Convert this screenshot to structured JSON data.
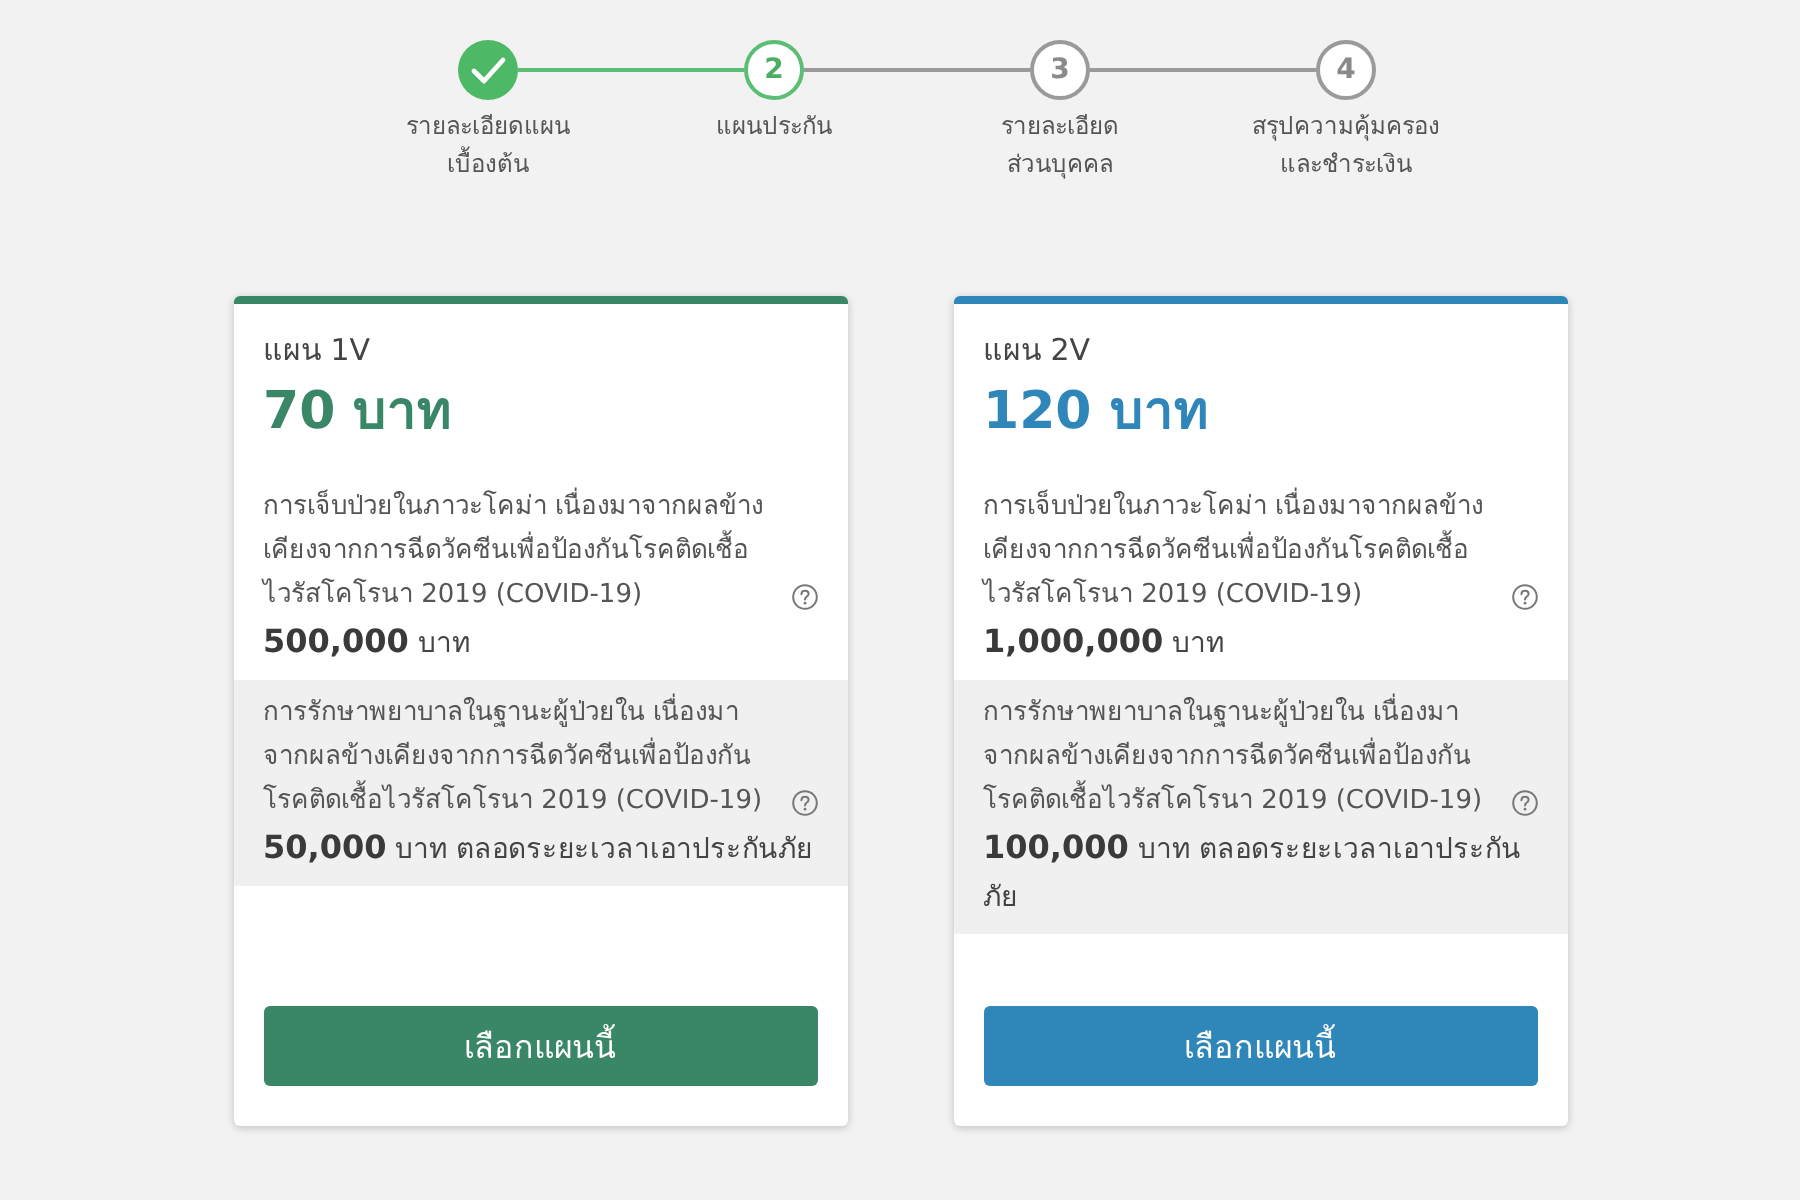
{
  "stepper": {
    "steps": [
      {
        "done": true,
        "selected": false,
        "label": "รายละเอียดแผน\nเบื้องต้น"
      },
      {
        "done": false,
        "selected": true,
        "number": "2",
        "label": "แผนประกัน"
      },
      {
        "done": false,
        "selected": false,
        "number": "3",
        "label": "รายละเอียด\nส่วนบุคคล"
      },
      {
        "done": false,
        "selected": false,
        "number": "4",
        "label": "สรุปความคุ้มครอง\nและชำระเงิน"
      }
    ]
  },
  "plans": [
    {
      "name": "แผน 1V",
      "price": "70 บาท",
      "color": "#3a8768",
      "coverages": [
        {
          "description": "การเจ็บป่วยในภาวะโคม่า เนื่องมาจากผลข้างเคียงจากการฉีดวัคซีนเพื่อป้องกันโรคติดเชื้อไวรัสโคโรนา 2019 (COVID-19)",
          "amount": "**500,000** บาท"
        },
        {
          "description": "การรักษาพยาบาลในฐานะผู้ป่วยใน เนื่องมาจากผลข้างเคียงจากการฉีดวัคซีนเพื่อป้องกันโรคติดเชื้อไวรัสโคโรนา 2019 (COVID-19)",
          "amount": "**50,000** บาท ตลอดระยะเวลาเอาประกันภัย"
        }
      ],
      "button": "เลือกแผนนี้"
    },
    {
      "name": "แผน 2V",
      "price": "120 บาท",
      "color": "#2e86b9",
      "coverages": [
        {
          "description": "การเจ็บป่วยในภาวะโคม่า เนื่องมาจากผลข้างเคียงจากการฉีดวัคซีนเพื่อป้องกันโรคติดเชื้อไวรัสโคโรนา 2019 (COVID-19)",
          "amount": "**1,000,000** บาท"
        },
        {
          "description": "การรักษาพยาบาลในฐานะผู้ป่วยใน เนื่องมาจากผลข้างเคียงจากการฉีดวัคซีนเพื่อป้องกันโรคติดเชื้อไวรัสโคโรนา 2019 (COVID-19)",
          "amount": "**100,000** บาท ตลอดระยะเวลาเอาประกันภัย"
        }
      ],
      "button": "เลือกแผนนี้"
    }
  ]
}
